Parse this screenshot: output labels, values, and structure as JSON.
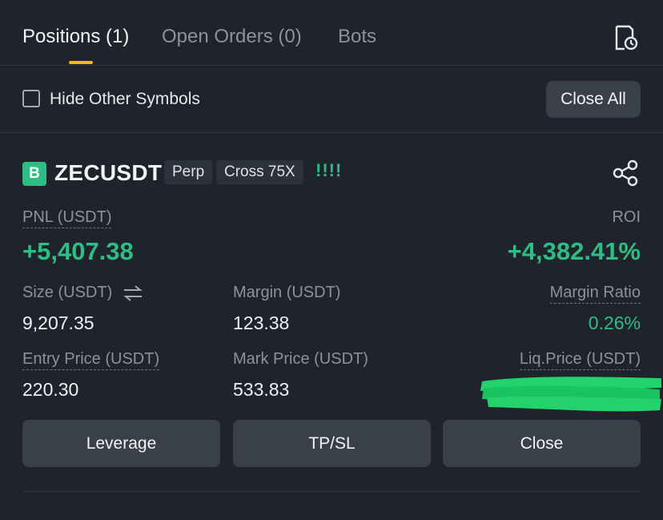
{
  "tabs": [
    {
      "label": "Positions (1)",
      "active": true
    },
    {
      "label": "Open Orders (0)",
      "active": false
    },
    {
      "label": "Bots",
      "active": false
    }
  ],
  "header_icons": {
    "history": "order-history-icon"
  },
  "filter": {
    "hide_other_symbols_label": "Hide Other Symbols",
    "hide_other_symbols_checked": false,
    "close_all_label": "Close All"
  },
  "position": {
    "badge": "B",
    "symbol": "ZECUSDT",
    "type_tag": "Perp",
    "margin_tag": "Cross 75X",
    "signal": "!!!!",
    "share_icon": "share-icon",
    "pnl_label": "PNL (USDT)",
    "pnl_value": "+5,407.38",
    "roi_label": "ROI",
    "roi_value": "+4,382.41%",
    "size_label": "Size (USDT)",
    "size_value": "9,207.35",
    "margin_label": "Margin (USDT)",
    "margin_value": "123.38",
    "margin_ratio_label": "Margin Ratio",
    "margin_ratio_value": "0.26%",
    "entry_price_label": "Entry Price (USDT)",
    "entry_price_value": "220.30",
    "mark_price_label": "Mark Price (USDT)",
    "mark_price_value": "533.83",
    "liq_price_label": "Liq.Price (USDT)"
  },
  "actions": {
    "leverage": "Leverage",
    "tpsl": "TP/SL",
    "close": "Close"
  },
  "colors": {
    "background": "#1f242c",
    "green": "#2ebd85",
    "accent": "#f0b90b",
    "button": "#3a4049"
  }
}
